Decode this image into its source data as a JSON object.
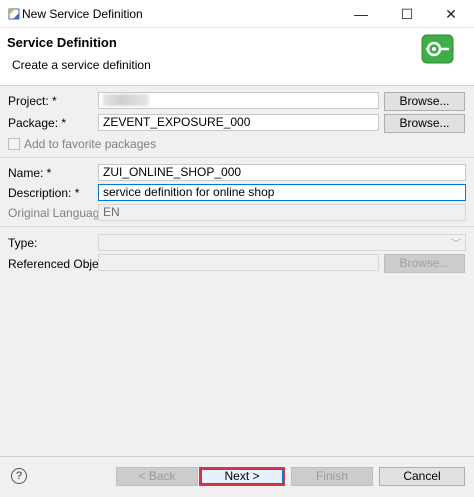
{
  "window": {
    "title": "New Service Definition",
    "controls": {
      "minimize": "—",
      "maximize": "☐",
      "close": "✕"
    }
  },
  "header": {
    "title": "Service Definition",
    "subtitle": "Create a service definition",
    "icon": "service-definition-icon",
    "icon_color": "#3fae49"
  },
  "form": {
    "project": {
      "label": "Project: *",
      "browse_label": "Browse..."
    },
    "package": {
      "label": "Package: *",
      "value": "ZEVENT_EXPOSURE_000",
      "browse_label": "Browse..."
    },
    "favorite": {
      "label": "Add to favorite packages",
      "checked": false
    },
    "name": {
      "label": "Name: *",
      "value": "ZUI_ONLINE_SHOP_000"
    },
    "description": {
      "label": "Description: *",
      "value": "service definition for online shop"
    },
    "original_language": {
      "label": "Original Language:",
      "value": "EN"
    },
    "type": {
      "label": "Type:",
      "value": ""
    },
    "referenced_object": {
      "label": "Referenced Object:",
      "value": "",
      "browse_label": "Browse..."
    }
  },
  "footer": {
    "help": "?",
    "back_label": "< Back",
    "next_label": "Next >",
    "finish_label": "Finish",
    "cancel_label": "Cancel"
  },
  "colors": {
    "focus": "#0078d7",
    "highlight": "#d8334a"
  }
}
